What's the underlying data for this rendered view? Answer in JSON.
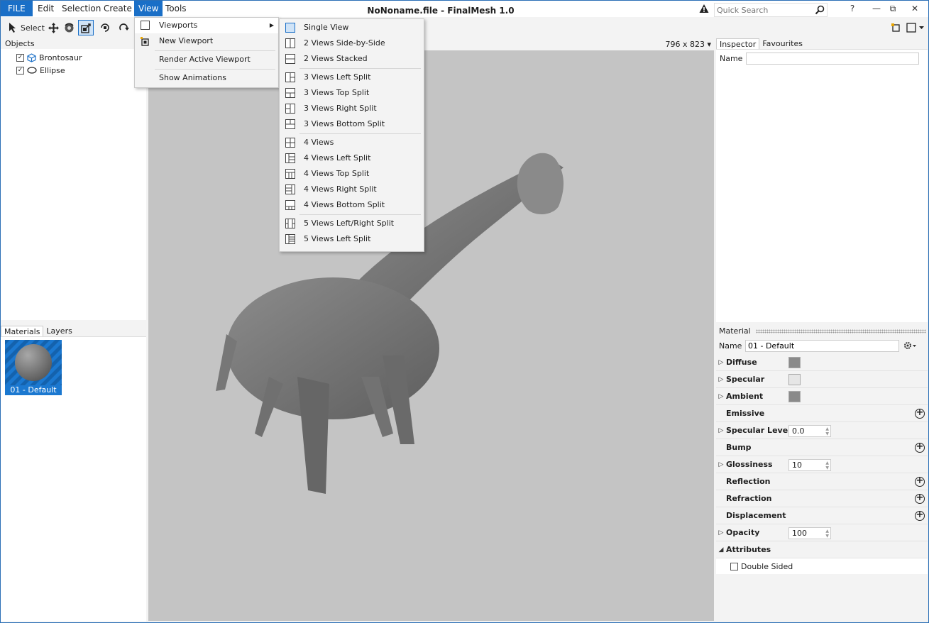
{
  "window": {
    "title": "NoNoname.file - FinalMesh 1.0"
  },
  "menubar": {
    "items": [
      "FILE",
      "Edit",
      "Selection",
      "Create",
      "View",
      "Tools"
    ]
  },
  "search": {
    "placeholder": "Quick Search"
  },
  "window_buttons": {
    "help": "?",
    "minimize": "—",
    "restore": "⧉",
    "close": "✕"
  },
  "toolbar": {
    "select_label": "Select"
  },
  "objects": {
    "header": "Objects",
    "items": [
      {
        "label": "Brontosaur",
        "checked": true
      },
      {
        "label": "Ellipse",
        "checked": true
      }
    ]
  },
  "materials": {
    "tabs": [
      "Materials",
      "Layers"
    ],
    "tile_label": "01 - Default"
  },
  "viewport": {
    "size_label": "796 x 823 ▾"
  },
  "inspector": {
    "tabs": [
      "Inspector",
      "Favourites"
    ],
    "name_label": "Name",
    "name_value": ""
  },
  "material_panel": {
    "title": "Material",
    "name_label": "Name",
    "name_value": "01 - Default",
    "rows": [
      {
        "label": "Diffuse",
        "tri": "▷",
        "swatch": "#8a8a8a"
      },
      {
        "label": "Specular",
        "tri": "▷",
        "swatch": "#e6e6e6"
      },
      {
        "label": "Ambient",
        "tri": "▷",
        "swatch": "#8a8a8a"
      },
      {
        "label": "Emissive",
        "tri": "",
        "plus": true
      },
      {
        "label": "Specular Level",
        "tri": "▷",
        "spin": "0.0"
      },
      {
        "label": "Bump",
        "tri": "",
        "plus": true
      },
      {
        "label": "Glossiness",
        "tri": "▷",
        "spin": "10"
      },
      {
        "label": "Reflection",
        "tri": "",
        "plus": true
      },
      {
        "label": "Refraction",
        "tri": "",
        "plus": true
      },
      {
        "label": "Displacement",
        "tri": "",
        "plus": true
      },
      {
        "label": "Opacity",
        "tri": "▷",
        "spin": "100"
      },
      {
        "label": "Attributes",
        "tri": "◢"
      }
    ],
    "double_sided_label": "Double Sided",
    "double_sided_checked": false
  },
  "view_menu": {
    "items": [
      "Viewports",
      "New Viewport",
      "Render Active Viewport",
      "Show Animations"
    ]
  },
  "viewports_submenu": {
    "items": [
      "Single View",
      "2 Views Side-by-Side",
      "2 Views Stacked",
      "3 Views Left Split",
      "3 Views Top Split",
      "3 Views Right Split",
      "3 Views Bottom Split",
      "4 Views",
      "4 Views Left Split",
      "4 Views Top Split",
      "4 Views Right Split",
      "4 Views Bottom Split",
      "5 Views Left/Right Split",
      "5 Views Left Split"
    ]
  }
}
